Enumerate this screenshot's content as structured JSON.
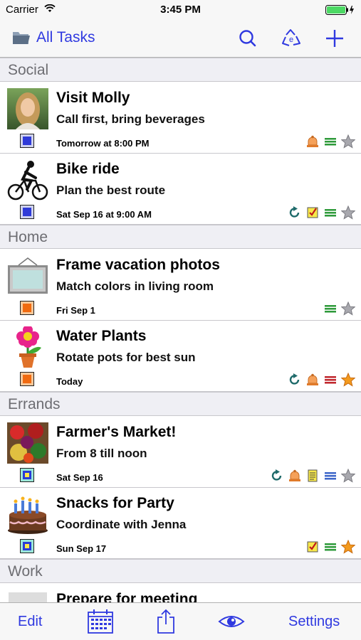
{
  "status_bar": {
    "carrier": "Carrier",
    "time": "3:45 PM"
  },
  "nav": {
    "title": "All Tasks",
    "icons": [
      "search-icon",
      "cloud-sync-icon",
      "add-icon"
    ]
  },
  "sections": [
    {
      "name": "Social",
      "tasks": [
        {
          "title": "Visit Molly",
          "note": "Call first, bring beverages",
          "due": "Tomorrow at 8:00 PM",
          "thumb": "portrait-photo",
          "priority": "blue",
          "alarm": true,
          "repeat": false,
          "checklist": false,
          "notes": false,
          "star": false,
          "bars": "green"
        },
        {
          "title": "Bike ride",
          "note": "Plan the best route",
          "due": "Sat Sep 16 at 9:00 AM",
          "thumb": "cyclist-icon",
          "priority": "blue",
          "alarm": false,
          "repeat": true,
          "checklist": true,
          "notes": false,
          "star": false,
          "bars": "green"
        }
      ]
    },
    {
      "name": "Home",
      "tasks": [
        {
          "title": "Frame vacation photos",
          "note": "Match colors in living room",
          "due": "Fri Sep 1",
          "thumb": "picture-frame-icon",
          "priority": "orange",
          "alarm": false,
          "repeat": false,
          "checklist": false,
          "notes": false,
          "star": false,
          "bars": "green"
        },
        {
          "title": "Water Plants",
          "note": "Rotate pots for best sun",
          "due": "Today",
          "thumb": "flower-pot-icon",
          "priority": "orange",
          "alarm": true,
          "repeat": true,
          "checklist": false,
          "notes": false,
          "star": true,
          "bars": "red"
        }
      ]
    },
    {
      "name": "Errands",
      "tasks": [
        {
          "title": "Farmer's Market!",
          "note": "From 8 till noon",
          "due": "Sat Sep 16",
          "thumb": "vegetables-photo",
          "priority": "teal",
          "alarm": true,
          "repeat": true,
          "checklist": false,
          "notes": true,
          "star": false,
          "bars": "blue"
        },
        {
          "title": "Snacks for Party",
          "note": "Coordinate with Jenna",
          "due": "Sun Sep 17",
          "thumb": "birthday-cake-icon",
          "priority": "teal",
          "alarm": false,
          "repeat": false,
          "checklist": true,
          "notes": false,
          "star": true,
          "bars": "green"
        }
      ]
    },
    {
      "name": "Work",
      "tasks": [
        {
          "title": "Prepare for meeting",
          "thumb": "meeting-icon"
        }
      ]
    }
  ],
  "tabbar": {
    "edit": "Edit",
    "settings": "Settings",
    "icons": [
      "calendar-icon",
      "share-icon",
      "eye-icon"
    ]
  },
  "colors": {
    "accent": "#2f39e0",
    "star_on": "#f39a1e",
    "bars_green": "#2e9a3a",
    "bars_red": "#c0262c",
    "bars_blue": "#3d66c9"
  }
}
